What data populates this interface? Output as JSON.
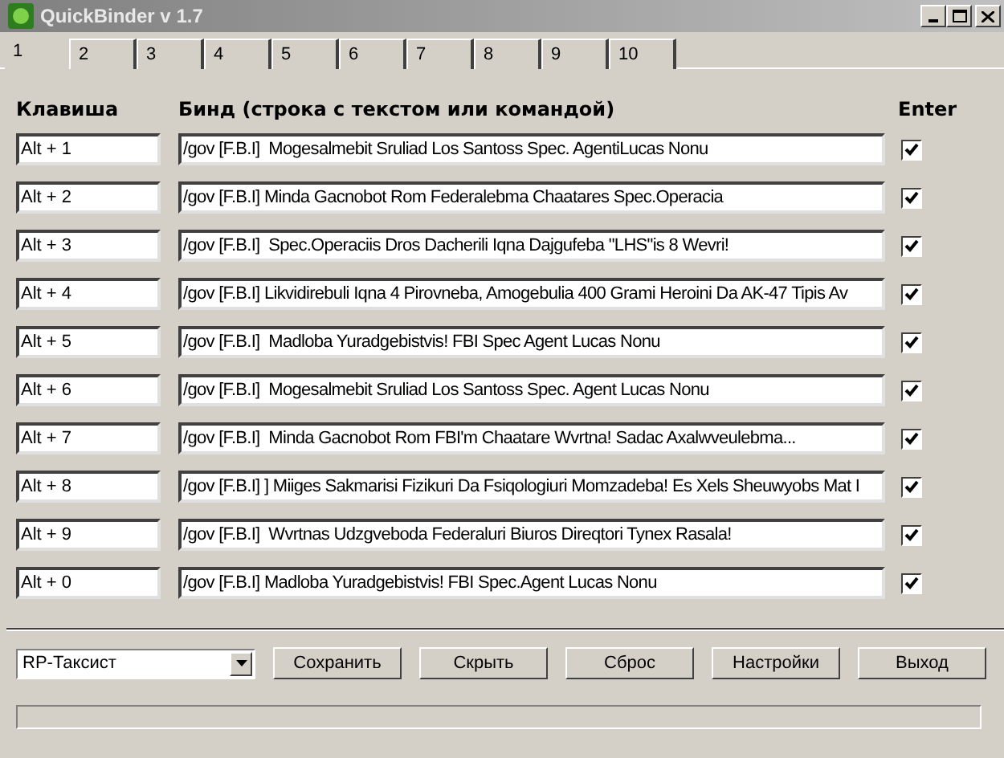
{
  "window": {
    "title": "QuickBinder v 1.7"
  },
  "tabs": [
    {
      "label": "1",
      "selected": true
    },
    {
      "label": "2",
      "selected": false
    },
    {
      "label": "3",
      "selected": false
    },
    {
      "label": "4",
      "selected": false
    },
    {
      "label": "5",
      "selected": false
    },
    {
      "label": "6",
      "selected": false
    },
    {
      "label": "7",
      "selected": false
    },
    {
      "label": "8",
      "selected": false
    },
    {
      "label": "9",
      "selected": false
    },
    {
      "label": "10",
      "selected": false
    }
  ],
  "columns": [
    "Клавиша",
    "Бинд (строка с текстом или командой)",
    "Enter"
  ],
  "binds": [
    {
      "key": "Alt + 1",
      "text": "/gov [F.B.I]  Mogesalmebit Sruliad Los Santoss Spec. AgentiLucas Nonu",
      "enter": true
    },
    {
      "key": "Alt + 2",
      "text": "/gov [F.B.I] Minda Gacnobot Rom Federalebma Chaatares Spec.Operacia",
      "enter": true
    },
    {
      "key": "Alt + 3",
      "text": "/gov [F.B.I]  Spec.Operaciis Dros Dacherili Iqna Dajgufeba \"LHS\"is 8 Wevri!",
      "enter": true
    },
    {
      "key": "Alt + 4",
      "text": "/gov [F.B.I] Likvidirebuli Iqna 4 Pirovneba, Amogebulia 400 Grami Heroini Da AK-47 Tipis Av",
      "enter": true
    },
    {
      "key": "Alt + 5",
      "text": "/gov [F.B.I]  Madloba Yuradgebistvis! FBI Spec Agent Lucas Nonu",
      "enter": true
    },
    {
      "key": "Alt + 6",
      "text": "/gov [F.B.I]  Mogesalmebit Sruliad Los Santoss Spec. Agent Lucas Nonu",
      "enter": true
    },
    {
      "key": "Alt + 7",
      "text": "/gov [F.B.I]  Minda Gacnobot Rom FBI'm Chaatare Wvrtna! Sadac Axalwveulebma...",
      "enter": true
    },
    {
      "key": "Alt + 8",
      "text": "/gov [F.B.I] ] Miiges Sakmarisi Fizikuri Da Fsiqologiuri Momzadeba! Es Xels Sheuwyobs Mat I",
      "enter": true
    },
    {
      "key": "Alt + 9",
      "text": "/gov [F.B.I]  Wvrtnas Udzgveboda Federaluri Biuros Direqtori Tynex Rasala!",
      "enter": true
    },
    {
      "key": "Alt + 0",
      "text": "/gov [F.B.I] Madloba Yuradgebistvis! FBI Spec.Agent Lucas Nonu",
      "enter": true
    }
  ],
  "profile": {
    "value": "RP-Таксист"
  },
  "buttons": [
    "Сохранить",
    "Скрыть",
    "Сброс",
    "Настройки",
    "Выход"
  ],
  "progress": {
    "level": 0
  }
}
